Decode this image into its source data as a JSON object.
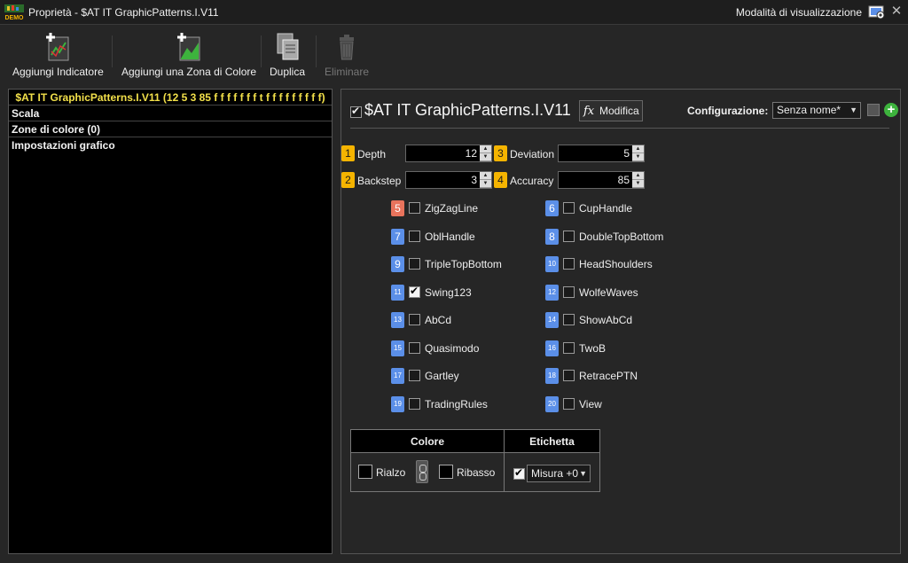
{
  "window": {
    "title": "Proprietà - $AT IT GraphicPatterns.I.V11",
    "logo_text": "DEMO",
    "mode_label": "Modalità di visualizzazione"
  },
  "toolbar": {
    "add_indicator": "Aggiungi Indicatore",
    "add_color_zone": "Aggiungi una Zona di Colore",
    "duplicate": "Duplica",
    "delete": "Eliminare"
  },
  "tree": {
    "items": [
      "$AT IT GraphicPatterns.I.V11 (12 5 3 85 f f f f f f f t f f f f f f f f f)",
      "Scala",
      "Zone di colore (0)",
      "Impostazioni grafico"
    ]
  },
  "indicator": {
    "enabled": true,
    "name": "$AT IT GraphicPatterns.I.V11",
    "modify_label": "Modifica",
    "fx_label": "fx",
    "config_label": "Configurazione:",
    "config_value": "Senza nome*"
  },
  "params": [
    {
      "num": "1",
      "label": "Depth",
      "value": "12"
    },
    {
      "num": "2",
      "label": "Backstep",
      "value": "3"
    },
    {
      "num": "3",
      "label": "Deviation",
      "value": "5"
    },
    {
      "num": "4",
      "label": "Accuracy",
      "value": "85"
    }
  ],
  "options_left": [
    {
      "num": "5",
      "label": "ZigZagLine",
      "checked": false
    },
    {
      "num": "7",
      "label": "OblHandle",
      "checked": false
    },
    {
      "num": "9",
      "label": "TripleTopBottom",
      "checked": false
    },
    {
      "num": "11",
      "label": "Swing123",
      "checked": true
    },
    {
      "num": "13",
      "label": "AbCd",
      "checked": false
    },
    {
      "num": "15",
      "label": "Quasimodo",
      "checked": false
    },
    {
      "num": "17",
      "label": "Gartley",
      "checked": false
    },
    {
      "num": "19",
      "label": "TradingRules",
      "checked": false
    }
  ],
  "options_right": [
    {
      "num": "6",
      "label": "CupHandle",
      "checked": false
    },
    {
      "num": "8",
      "label": "DoubleTopBottom",
      "checked": false
    },
    {
      "num": "10",
      "label": "HeadShoulders",
      "checked": false
    },
    {
      "num": "12",
      "label": "WolfeWaves",
      "checked": false
    },
    {
      "num": "14",
      "label": "ShowAbCd",
      "checked": false
    },
    {
      "num": "16",
      "label": "TwoB",
      "checked": false
    },
    {
      "num": "18",
      "label": "RetracePTN",
      "checked": false
    },
    {
      "num": "20",
      "label": "View",
      "checked": false
    }
  ],
  "style": {
    "color_header": "Colore",
    "label_header": "Etichetta",
    "up_label": "Rialzo",
    "down_label": "Ribasso",
    "measure_value": "Misura +0",
    "measure_checked": true
  },
  "colors": {
    "badge_yellow": "#f5b400",
    "badge_orange": "#e8735c",
    "badge_blue": "#5b8fe8",
    "selected_tree_text": "#f2e04a"
  }
}
